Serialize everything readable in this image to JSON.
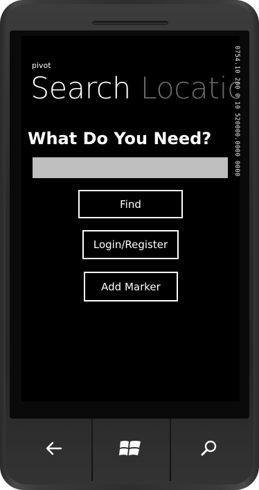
{
  "app": {
    "pivot_label": "pivot",
    "headers": [
      "Search",
      "Locatio"
    ]
  },
  "search": {
    "question": "What Do You Need?",
    "input_value": "",
    "input_placeholder": ""
  },
  "buttons": {
    "find": "Find",
    "login": "Login/Register",
    "add_marker": "Add Marker"
  },
  "side_counter": {
    "value": "0754.10 200 0 10 520000.0000 0000",
    "highlight": "0000"
  },
  "hardware_nav": {
    "back_icon": "back-arrow-icon",
    "start_icon": "windows-logo-icon",
    "search_icon": "search-icon"
  },
  "colors": {
    "screen_bg": "#000000",
    "text": "#ffffff",
    "inactive_header": "#6a6a6a",
    "input_bg": "#bfbfbf",
    "counter_highlight": "#e03030"
  }
}
